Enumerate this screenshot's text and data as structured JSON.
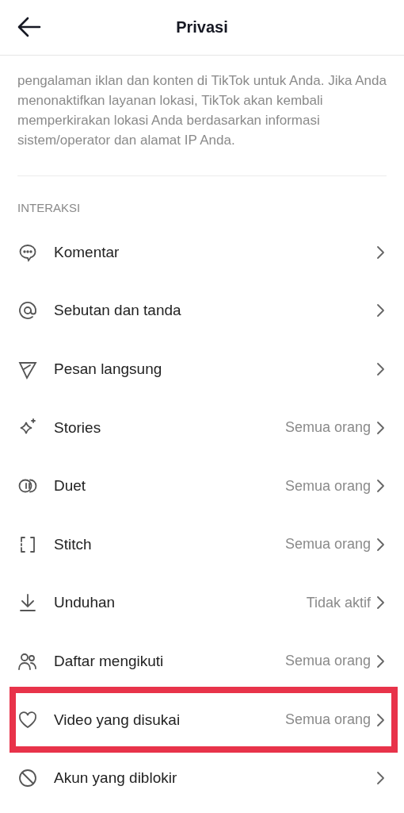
{
  "header": {
    "title": "Privasi"
  },
  "description": "pengalaman iklan dan konten di TikTok untuk Anda. Jika Anda menonaktifkan layanan lokasi, TikTok akan kembali memperkirakan lokasi Anda berdasarkan informasi sistem/operator dan alamat IP Anda.",
  "section": {
    "title": "INTERAKSI",
    "items": [
      {
        "kind": "comment",
        "label": "Komentar",
        "highlighted": false
      },
      {
        "kind": "mention",
        "label": "Sebutan dan tanda",
        "highlighted": false
      },
      {
        "kind": "message",
        "label": "Pesan langsung",
        "highlighted": false
      },
      {
        "kind": "stories",
        "label": "Stories",
        "value": "Semua orang",
        "highlighted": false
      },
      {
        "kind": "duet",
        "label": "Duet",
        "value": "Semua orang",
        "highlighted": false
      },
      {
        "kind": "stitch",
        "label": "Stitch",
        "value": "Semua orang",
        "highlighted": false
      },
      {
        "kind": "download",
        "label": "Unduhan",
        "value": "Tidak aktif",
        "highlighted": false
      },
      {
        "kind": "following",
        "label": "Daftar mengikuti",
        "value": "Semua orang",
        "highlighted": false
      },
      {
        "kind": "liked",
        "label": "Video yang disukai",
        "value": "Semua orang",
        "highlighted": true
      },
      {
        "kind": "blocked",
        "label": "Akun yang diblokir",
        "highlighted": false
      }
    ]
  }
}
